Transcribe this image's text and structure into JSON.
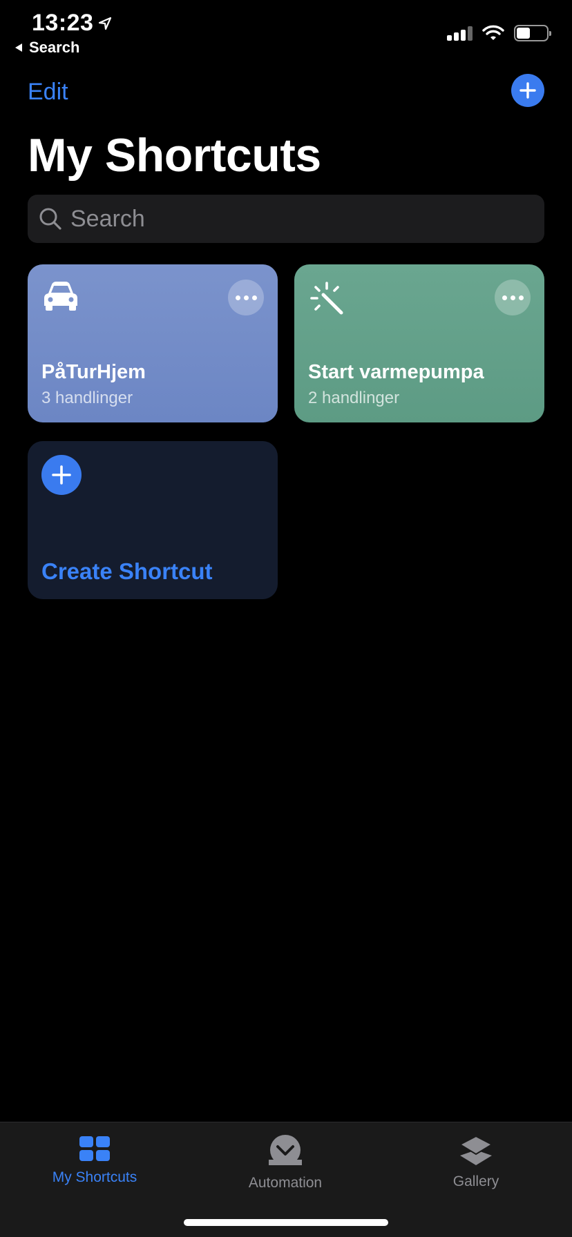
{
  "status_bar": {
    "time": "13:23",
    "back_label": "Search"
  },
  "nav": {
    "edit_label": "Edit",
    "title": "My Shortcuts"
  },
  "search": {
    "placeholder": "Search"
  },
  "shortcuts": [
    {
      "title": "PåTurHjem",
      "subtitle": "3 handlinger",
      "icon": "car-icon",
      "color": "#7288c8"
    },
    {
      "title": "Start varmepumpa",
      "subtitle": "2 handlinger",
      "icon": "magic-wand-icon",
      "color": "#62a189"
    }
  ],
  "create": {
    "label": "Create Shortcut"
  },
  "tabs": [
    {
      "label": "My Shortcuts",
      "icon": "grid-icon",
      "active": true
    },
    {
      "label": "Automation",
      "icon": "clock-check-icon",
      "active": false
    },
    {
      "label": "Gallery",
      "icon": "layers-icon",
      "active": false
    }
  ],
  "colors": {
    "accent": "#3a82f7",
    "background": "#000000"
  }
}
